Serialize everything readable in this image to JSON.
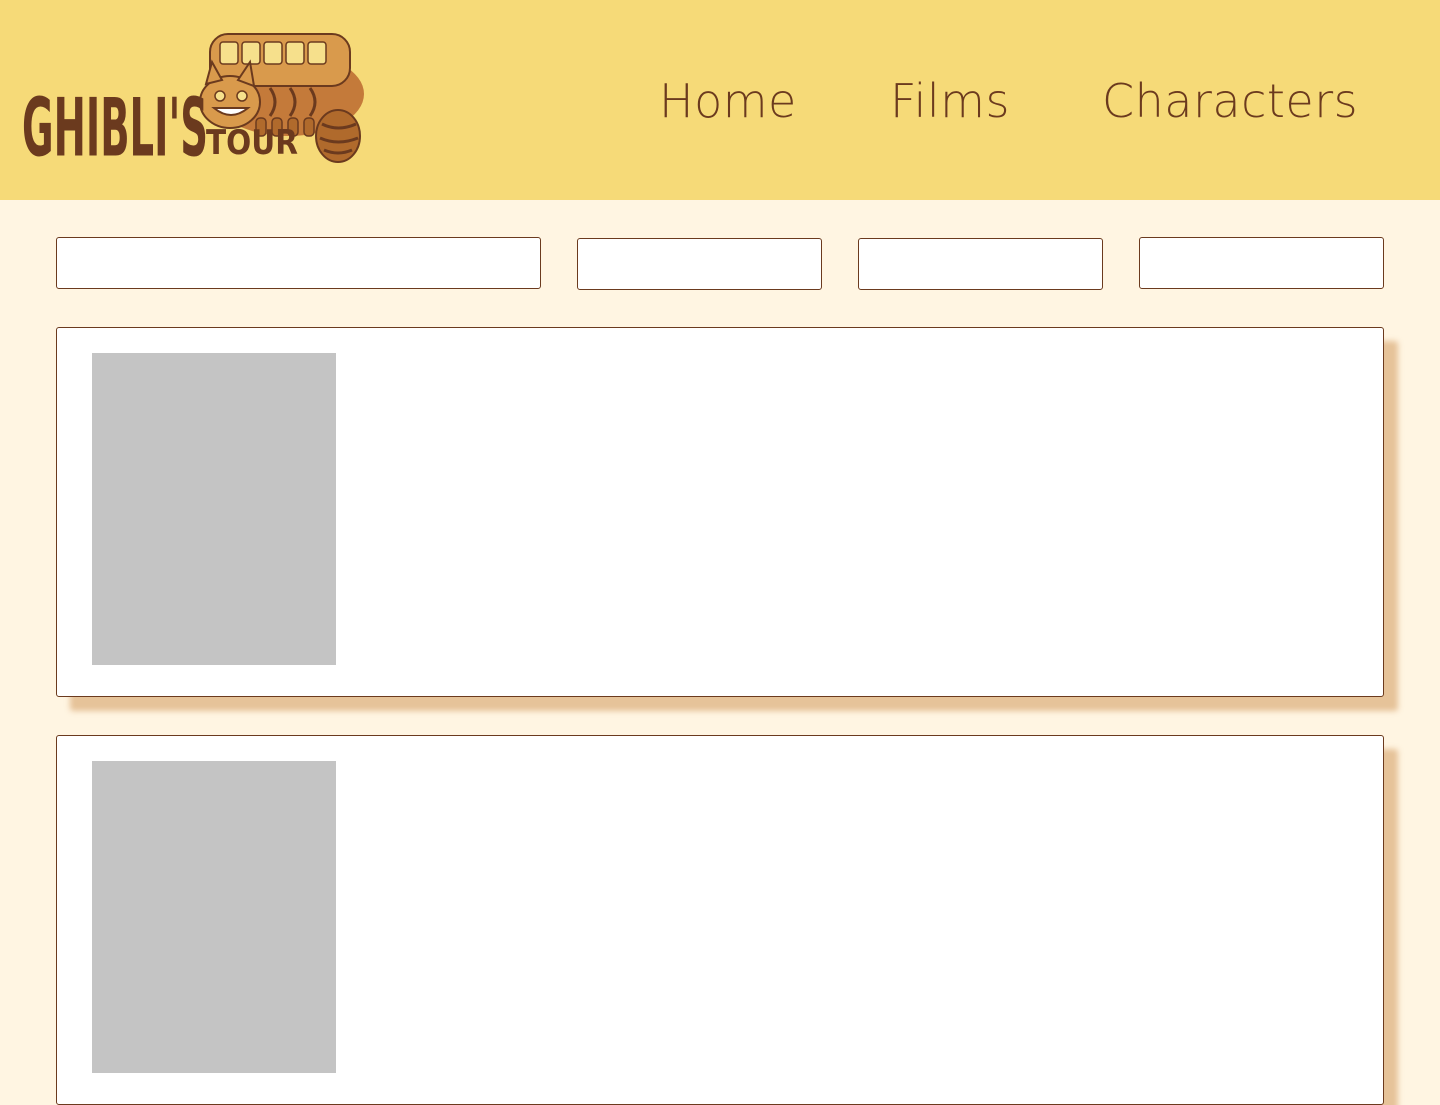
{
  "header": {
    "logo": {
      "text_main": "GHIBLI'S",
      "text_sub": "TOUR",
      "icon": "catbus-icon"
    },
    "nav": [
      {
        "label": "Home"
      },
      {
        "label": "Films"
      },
      {
        "label": "Characters"
      }
    ]
  },
  "filters": {
    "search": {
      "value": "",
      "placeholder": ""
    },
    "filter_1": {
      "value": "",
      "placeholder": ""
    },
    "filter_2": {
      "value": "",
      "placeholder": ""
    },
    "filter_3": {
      "value": "",
      "placeholder": ""
    }
  },
  "cards": [
    {
      "image": "placeholder-image"
    },
    {
      "image": "placeholder-image"
    }
  ],
  "colors": {
    "header_bg": "#f6da78",
    "page_bg": "#fff5e2",
    "brand_brown": "#6b3a1e",
    "card_shadow": "#e8c6a0",
    "image_placeholder": "#c4c4c4"
  }
}
